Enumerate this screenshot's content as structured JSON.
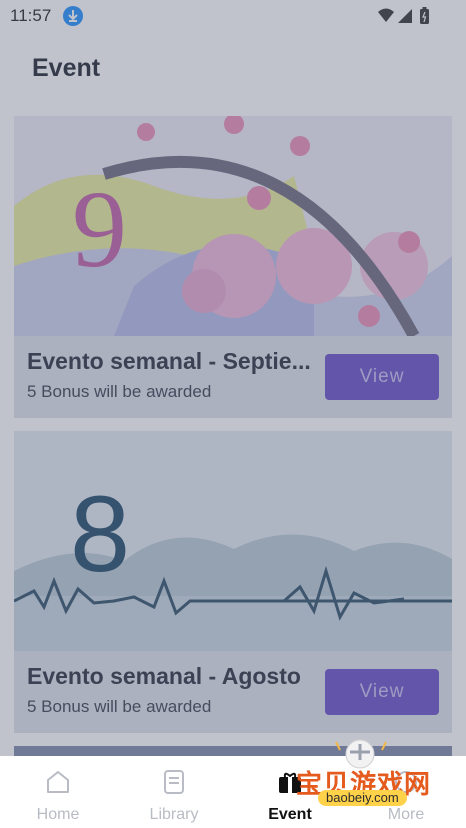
{
  "status": {
    "time": "11:57"
  },
  "page": {
    "title": "Event"
  },
  "events": [
    {
      "number": "9",
      "title": "Evento semanal - Septie...",
      "subtitle": "5 Bonus will be awarded",
      "button": "View"
    },
    {
      "number": "8",
      "title": "Evento semanal - Agosto",
      "subtitle": "5 Bonus will be awarded",
      "button": "View"
    }
  ],
  "nav": [
    {
      "label": "Home",
      "icon": "home-icon"
    },
    {
      "label": "Library",
      "icon": "book-icon"
    },
    {
      "label": "Event",
      "icon": "gift-icon"
    },
    {
      "label": "More",
      "icon": "more-icon"
    }
  ],
  "watermark": {
    "text": "宝贝游戏网",
    "url": "baobeiy.com"
  },
  "colors": {
    "accent": "#6a4fc8",
    "overlay": "#5a6078"
  }
}
